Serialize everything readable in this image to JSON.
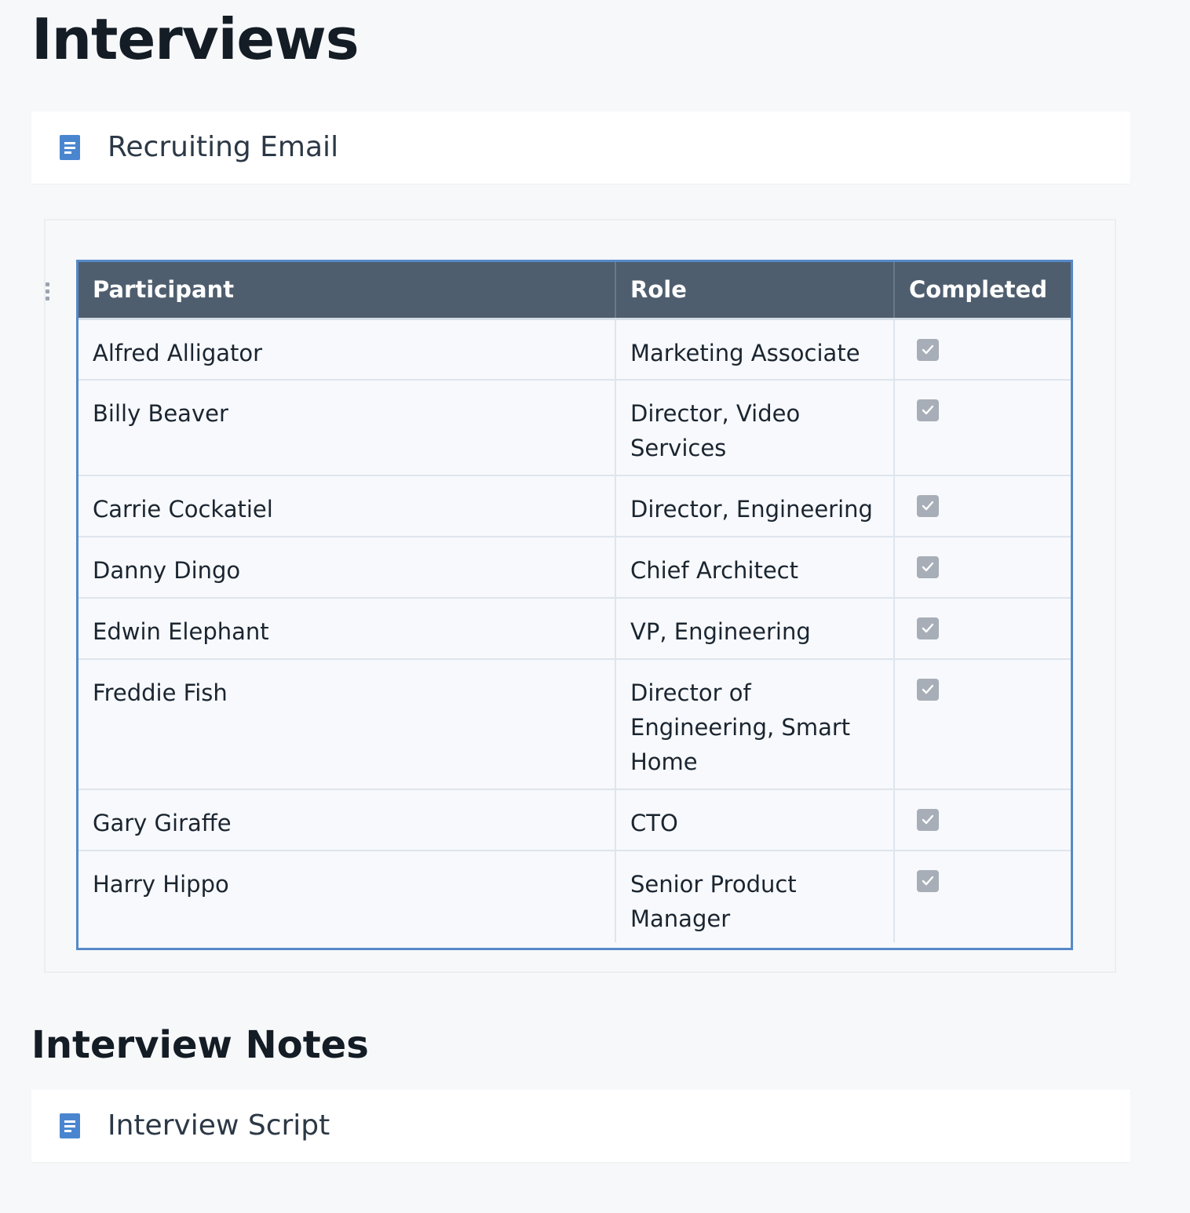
{
  "page": {
    "title": "Interviews"
  },
  "recruiting_doc": {
    "label": "Recruiting Email",
    "icon": "document-icon"
  },
  "table": {
    "columns": [
      "Participant",
      "Role",
      "Completed"
    ],
    "rows": [
      {
        "participant": "Alfred Alligator",
        "role": "Marketing Associate",
        "completed": true
      },
      {
        "participant": "Billy Beaver",
        "role": "Director, Video Services",
        "completed": true
      },
      {
        "participant": "Carrie Cockatiel",
        "role": "Director, Engineering",
        "completed": true
      },
      {
        "participant": "Danny Dingo",
        "role": "Chief Architect",
        "completed": true
      },
      {
        "participant": "Edwin Elephant",
        "role": "VP, Engineering",
        "completed": true
      },
      {
        "participant": "Freddie Fish",
        "role": "Director of Engineering, Smart Home",
        "completed": true
      },
      {
        "participant": "Gary Giraffe",
        "role": "CTO",
        "completed": true
      },
      {
        "participant": "Harry Hippo",
        "role": "Senior Product Manager",
        "completed": true
      }
    ]
  },
  "notes_section": {
    "heading": "Interview Notes"
  },
  "script_doc": {
    "label": "Interview Script",
    "icon": "document-icon"
  },
  "colors": {
    "header_bg": "#4f5e6e",
    "table_border": "#5689c8",
    "doc_icon": "#4a86cf",
    "checkbox": "#a7aeb7"
  }
}
